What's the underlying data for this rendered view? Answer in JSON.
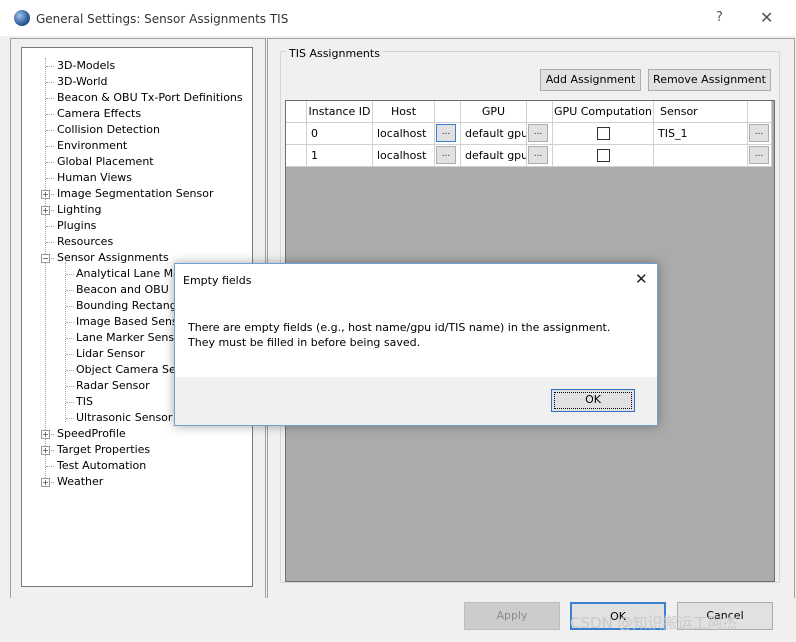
{
  "window": {
    "title": "General Settings: Sensor Assignments TIS",
    "help": "?",
    "close": "✕"
  },
  "tree": {
    "items": [
      {
        "label": "3D-Models"
      },
      {
        "label": "3D-World"
      },
      {
        "label": "Beacon & OBU Tx-Port Definitions"
      },
      {
        "label": "Camera Effects"
      },
      {
        "label": "Collision Detection"
      },
      {
        "label": "Environment"
      },
      {
        "label": "Global Placement"
      },
      {
        "label": "Human Views"
      },
      {
        "label": "Image Segmentation Sensor",
        "expander": "+"
      },
      {
        "label": "Lighting",
        "expander": "+"
      },
      {
        "label": "Plugins"
      },
      {
        "label": "Resources"
      },
      {
        "label": "Sensor Assignments",
        "expander": "−"
      },
      {
        "label": "Analytical Lane Marker S"
      },
      {
        "label": "Beacon and OBU"
      },
      {
        "label": "Bounding Rectangle Se"
      },
      {
        "label": "Image Based Sensor"
      },
      {
        "label": "Lane Marker Sensor"
      },
      {
        "label": "Lidar Sensor"
      },
      {
        "label": "Object Camera Sensor"
      },
      {
        "label": "Radar Sensor"
      },
      {
        "label": "TIS"
      },
      {
        "label": "Ultrasonic Sensor"
      },
      {
        "label": "SpeedProfile",
        "expander": "+"
      },
      {
        "label": "Target Properties",
        "expander": "+"
      },
      {
        "label": "Test Automation"
      },
      {
        "label": "Weather",
        "expander": "+"
      }
    ]
  },
  "tis": {
    "group_title": "TIS Assignments",
    "add_button": "Add Assignment",
    "remove_button": "Remove Assignment",
    "columns": [
      "Instance ID",
      "Host",
      "GPU",
      "GPU Computation",
      "Sensor"
    ],
    "ellipsis": "...",
    "rows": [
      {
        "instance_id": "0",
        "host": "localhost",
        "gpu": "default gpu",
        "gpu_computation": false,
        "sensor": "TIS_1"
      },
      {
        "instance_id": "1",
        "host": "localhost",
        "gpu": "default gpu",
        "gpu_computation": false,
        "sensor": ""
      }
    ]
  },
  "footer": {
    "apply": "Apply",
    "ok": "OK",
    "cancel": "Cancel"
  },
  "dialog": {
    "title": "Empty fields",
    "close": "✕",
    "message": "There are empty fields (e.g., host name/gpu id/TIS name) in the assignment. They must be filled in before being saved.",
    "ok": "OK"
  },
  "watermark": "CSDN @知识搬运工阿杰"
}
